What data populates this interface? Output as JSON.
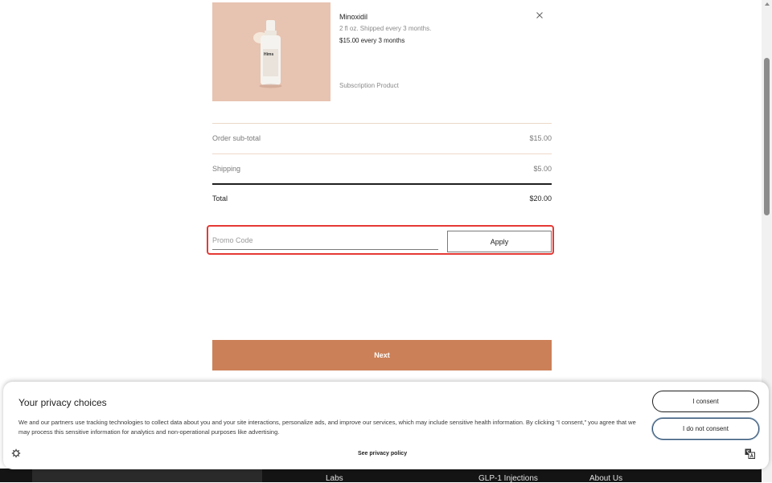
{
  "product": {
    "name": "Minoxidil",
    "description": "2 fl oz. Shipped every 3 months.",
    "price": "$15.00 every 3 months",
    "type": "Subscription Product",
    "image_label": "Hims",
    "image_bg": "#e7c3b1"
  },
  "summary": {
    "subtotal_label": "Order sub-total",
    "subtotal_value": "$15.00",
    "shipping_label": "Shipping",
    "shipping_value": "$5.00",
    "total_label": "Total",
    "total_value": "$20.00"
  },
  "promo": {
    "placeholder": "Promo Code",
    "value": "",
    "apply_label": "Apply"
  },
  "next_label": "Next",
  "footer": {
    "links": [
      "Labs",
      "GLP-1 Injections",
      "About Us"
    ]
  },
  "consent": {
    "title": "Your privacy choices",
    "text": "We and our partners use tracking technologies to collect data about you and your site interactions, personalize ads, and improve our services, which may include sensitive health information. By clicking “I consent,” you agree that we may process this sensitive information for analytics and non-operational purposes like advertising.",
    "consent_label": "I consent",
    "deny_label": "I do not consent",
    "privacy_link": "See privacy policy"
  },
  "icons": {
    "remove": "close-icon",
    "settings": "gear-icon",
    "translate": "translate-icon"
  },
  "colors": {
    "accent": "#cc8057",
    "highlight": "#e53935"
  }
}
